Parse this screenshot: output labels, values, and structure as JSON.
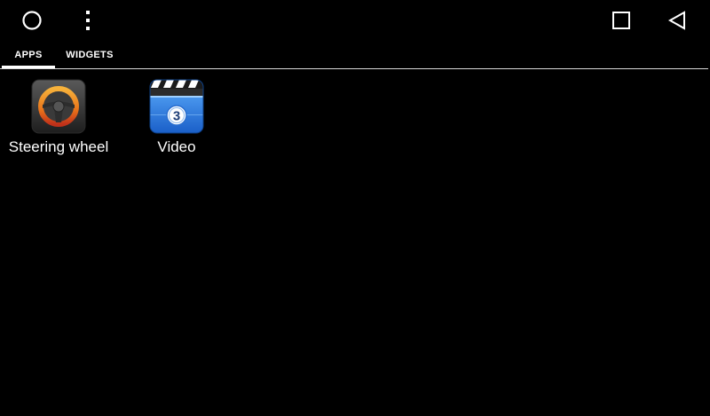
{
  "navbar": {
    "home_icon": "circle-home-icon",
    "menu_icon": "vertical-dots-icon",
    "recents_icon": "square-recents-icon",
    "back_icon": "triangle-back-icon"
  },
  "tabs": [
    {
      "label": "APPS",
      "selected": true
    },
    {
      "label": "WIDGETS",
      "selected": false
    }
  ],
  "apps": [
    {
      "label": "Steering wheel",
      "icon": "steering-wheel-icon"
    },
    {
      "label": "Video",
      "icon": "video-clapperboard-icon",
      "badge": "3"
    }
  ],
  "colors": {
    "background": "#000000",
    "text": "#ffffff",
    "divider": "#d8d8d8",
    "steering_orange": "#f08a1c",
    "video_blue": "#2a7fe0"
  }
}
